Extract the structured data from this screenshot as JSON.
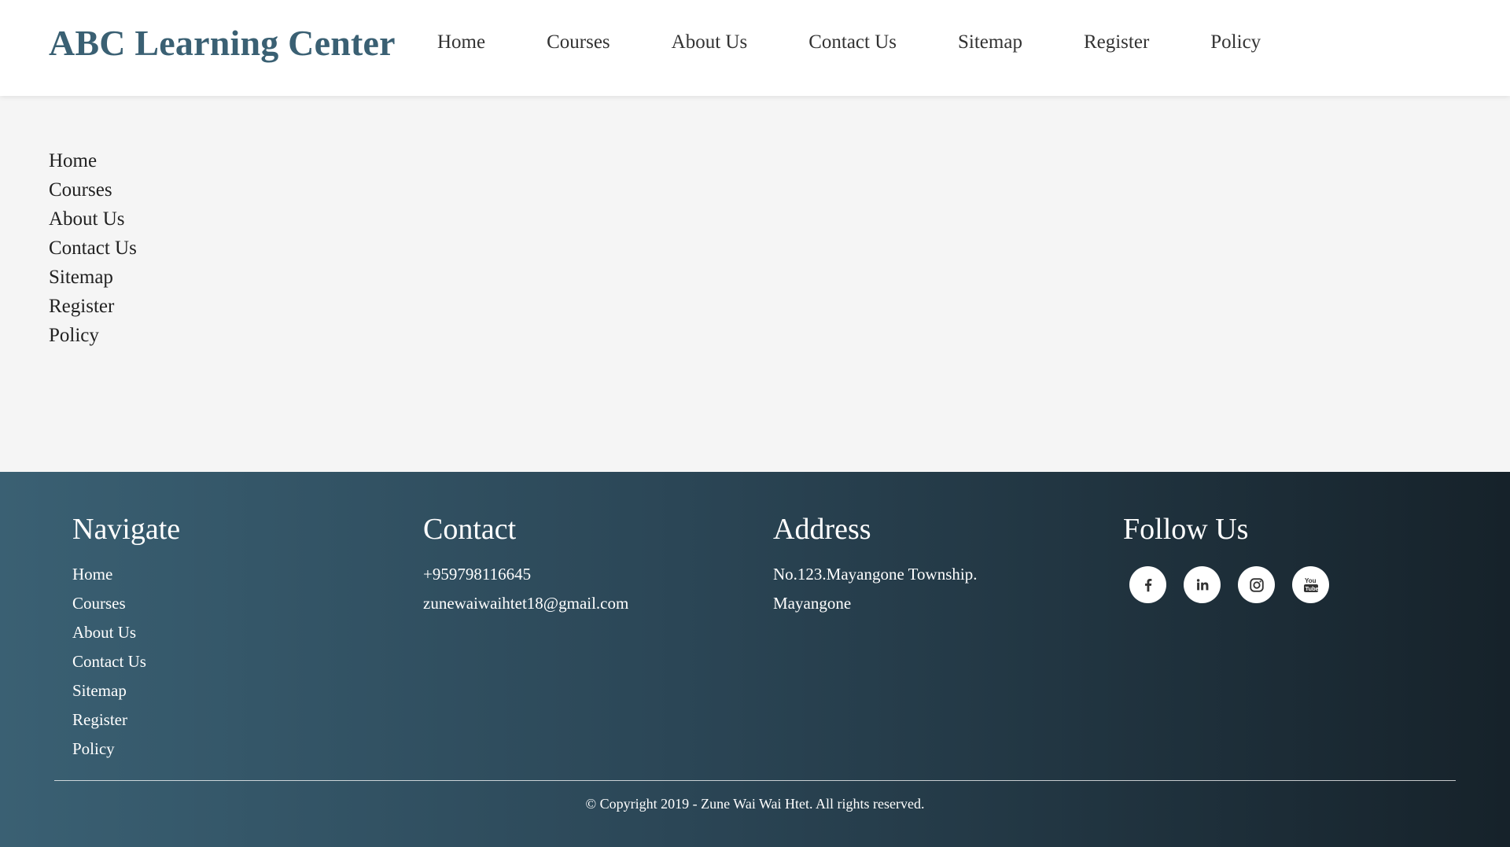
{
  "header": {
    "brand": "ABC Learning Center",
    "nav": [
      "Home",
      "Courses",
      "About Us",
      "Contact Us",
      "Sitemap",
      "Register",
      "Policy"
    ]
  },
  "main": {
    "sitemap_links": [
      "Home",
      "Courses",
      "About Us",
      "Contact Us",
      "Sitemap",
      "Register",
      "Policy"
    ]
  },
  "footer": {
    "navigate": {
      "heading": "Navigate",
      "links": [
        "Home",
        "Courses",
        "About Us",
        "Contact Us",
        "Sitemap",
        "Register",
        "Policy"
      ]
    },
    "contact": {
      "heading": "Contact",
      "phone": "+959798116645",
      "email": "zunewaiwaihtet18@gmail.com"
    },
    "address": {
      "heading": "Address",
      "line1": "No.123.Mayangone Township.",
      "line2": "Mayangone"
    },
    "follow": {
      "heading": "Follow Us",
      "icons": [
        "facebook-icon",
        "linkedin-icon",
        "instagram-icon",
        "youtube-icon"
      ]
    },
    "copyright": "© Copyright 2019 - Zune Wai Wai Htet. All rights reserved."
  },
  "colors": {
    "brand": "#3a6073",
    "footer_gradient_start": "#3a6073",
    "footer_gradient_end": "#16222a",
    "page_bg": "#f5f5f5"
  }
}
